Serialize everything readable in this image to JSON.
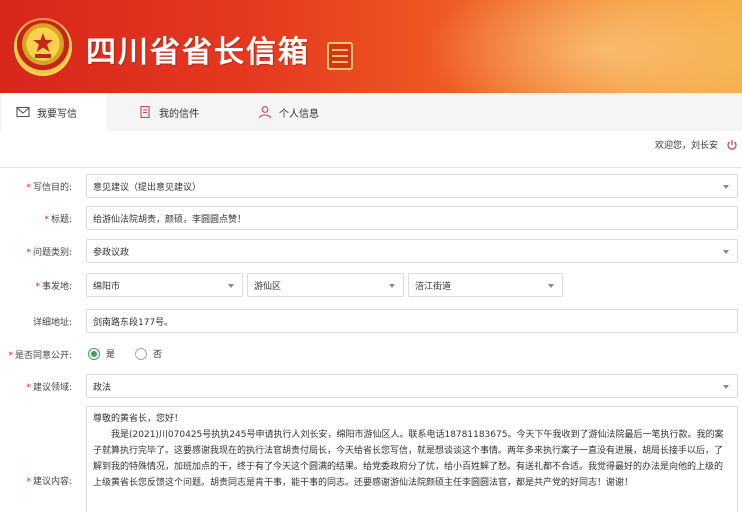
{
  "header": {
    "title": "四川省省长信箱",
    "seal_text": "省长信箱"
  },
  "tabs": [
    {
      "label": "我要写信",
      "icon": "mail-icon",
      "active": true
    },
    {
      "label": "我的信件",
      "icon": "document-icon",
      "active": false
    },
    {
      "label": "个人信息",
      "icon": "person-icon",
      "active": false
    }
  ],
  "welcome": "欢迎您，刘长安",
  "form": {
    "purpose": {
      "label": "写信目的:",
      "value": "意见建议（提出意见建议）"
    },
    "subject": {
      "label": "标题:",
      "value": "给游仙法院胡贵，颜硕，李圆圆点赞！"
    },
    "category": {
      "label": "问题类别:",
      "value": "参政议政"
    },
    "location": {
      "label": "事发地:",
      "city": "绵阳市",
      "district": "游仙区",
      "street": "涪江街道"
    },
    "address": {
      "label": "详细地址:",
      "value": "剑南路东段177号。"
    },
    "public": {
      "label": "是否同意公开:",
      "yes": "是",
      "no": "否",
      "selected": "是"
    },
    "domain": {
      "label": "建议领域:",
      "value": "政法"
    },
    "content": {
      "label": "建议内容:",
      "greeting": "尊敬的黄省长，您好！",
      "body": "我是(2021)川070425号执执245号申请执行人刘长安，绵阳市游仙区人。联系电话18781183675。今天下午我收到了游仙法院最后一笔执行款。我的案子就算执行完毕了。这要感谢我现在的执行法官胡贵付局长，今天给省长您写信，就是想谈谈这个事情。两年多来执行案子一直没有进展，胡局长接手以后，了解到我的特殊情况，加班加点的干，终于有了今天这个圆满的结果。给党委政府分了忧，给小百姓解了愁。有送礼都不合适。我觉得最好的办法是向他的上级的上级黄省长您反馈这个问题。胡贵同志是肯干事，能干事的同志。还要感谢游仙法院颜硕主任李圆圆法官，都是共产党的好同志！谢谢！"
    }
  },
  "colors": {
    "banner_start": "#d8261b",
    "banner_end": "#f6b04a",
    "required": "#e02020",
    "radio_checked": "#3aa05a"
  }
}
